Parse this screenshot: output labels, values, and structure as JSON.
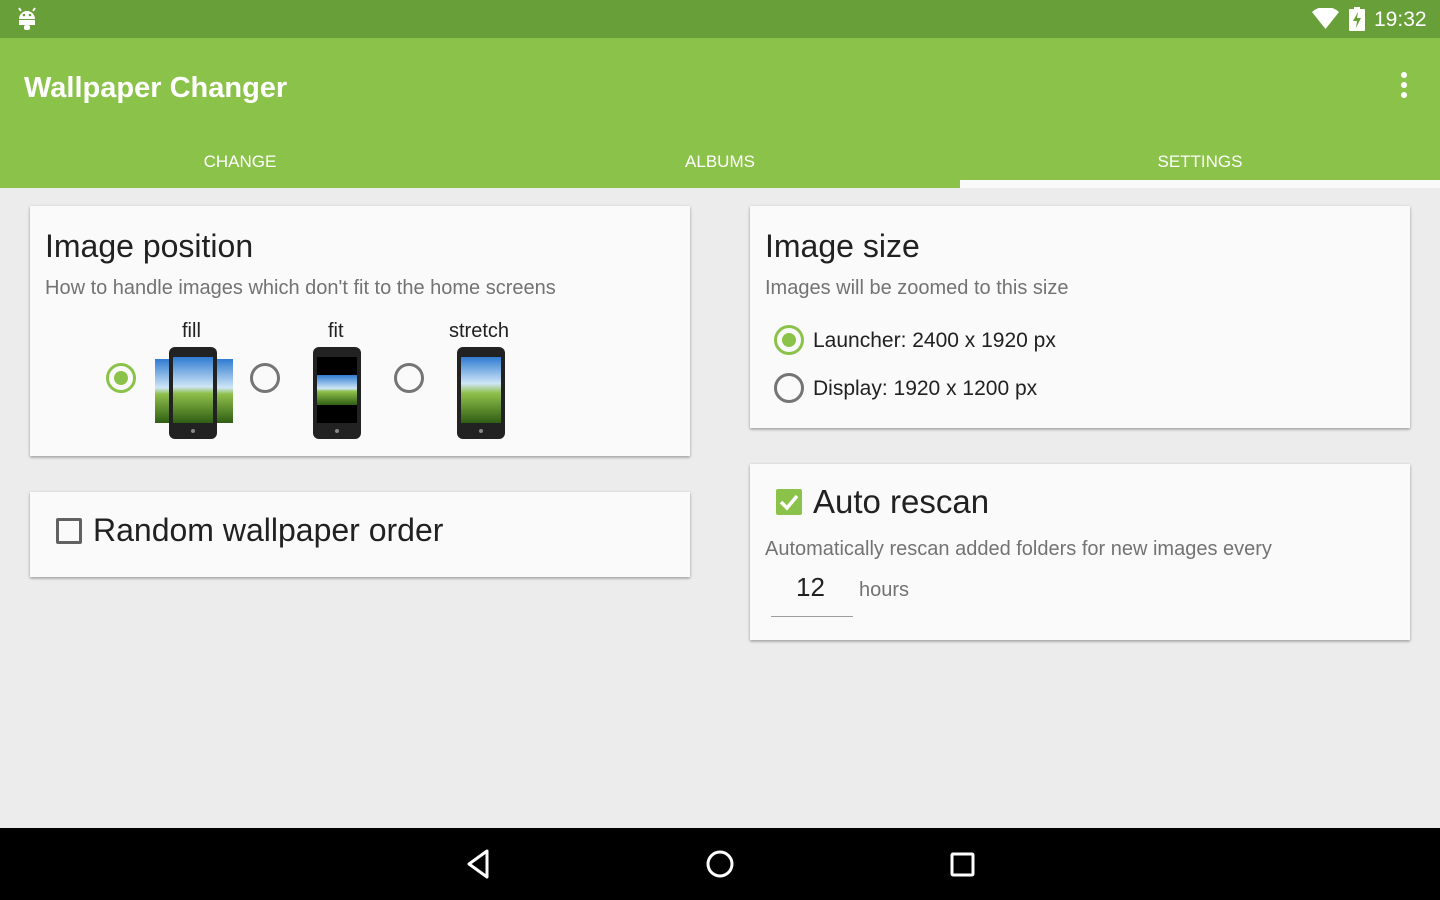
{
  "status_bar": {
    "time": "19:32",
    "icons": [
      "android-icon",
      "wifi-icon",
      "battery-charging-icon"
    ]
  },
  "app": {
    "title": "Wallpaper Changer",
    "overflow_icon": "more-vert-icon"
  },
  "tabs": [
    {
      "label": "CHANGE",
      "active": false
    },
    {
      "label": "ALBUMS",
      "active": false
    },
    {
      "label": "SETTINGS",
      "active": true
    }
  ],
  "image_position": {
    "title": "Image position",
    "subtitle": "How to handle images which don't fit to the home screens",
    "options": [
      {
        "label": "fill",
        "selected": true
      },
      {
        "label": "fit",
        "selected": false
      },
      {
        "label": "stretch",
        "selected": false
      }
    ]
  },
  "random_order": {
    "label": "Random wallpaper order",
    "checked": false
  },
  "image_size": {
    "title": "Image size",
    "subtitle": "Images will be zoomed to this size",
    "options": [
      {
        "label": "Launcher: 2400 x 1920 px",
        "selected": true
      },
      {
        "label": "Display: 1920 x 1200 px",
        "selected": false
      }
    ]
  },
  "auto_rescan": {
    "title": "Auto rescan",
    "checked": true,
    "subtitle": "Automatically rescan added folders for new images every",
    "interval_value": "12",
    "interval_unit": "hours"
  },
  "nav_bar": {
    "buttons": [
      "back-icon",
      "home-icon",
      "recents-icon"
    ]
  },
  "colors": {
    "status_bar": "#689f38",
    "primary": "#8bc34a",
    "background": "#ececec",
    "card": "#fafafa"
  }
}
